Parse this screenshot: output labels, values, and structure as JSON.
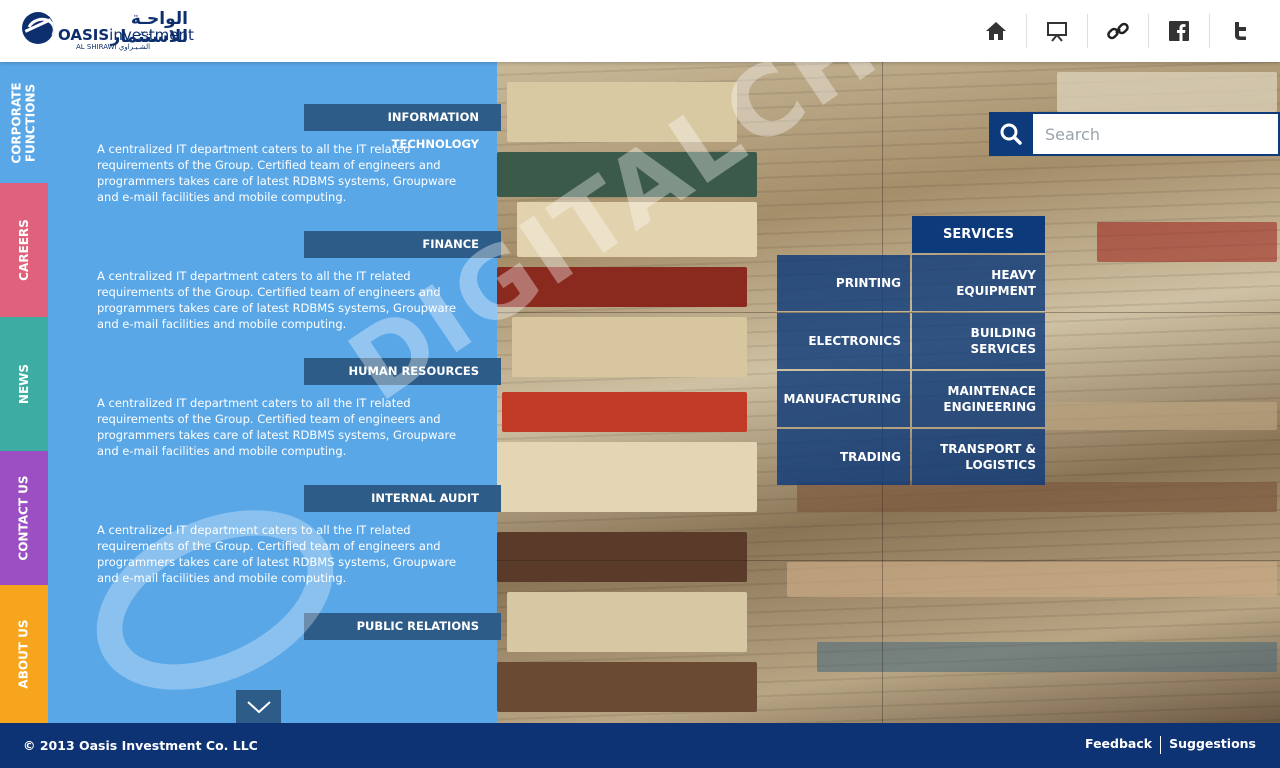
{
  "logo": {
    "arabic": "الواحـة للاستثمار",
    "name_bold": "OASIS",
    "name_rest": "investment",
    "sub_left": "AL SHIRAWI",
    "sub_right": "الشـيـراوي"
  },
  "header_icons": [
    "home-icon",
    "presentation-icon",
    "link-icon",
    "facebook-icon",
    "twitter-icon"
  ],
  "side_tabs": [
    {
      "label": "CORPORATE\nFUNCTIONS",
      "color": "#5aa7e8"
    },
    {
      "label": "CAREERS",
      "color": "#e0617c"
    },
    {
      "label": "NEWS",
      "color": "#3dada3"
    },
    {
      "label": "CONTACT US",
      "color": "#9b4fc2"
    },
    {
      "label": "ABOUT US",
      "color": "#f6a51c"
    }
  ],
  "departments": [
    {
      "title": "INFORMATION TECHNOLOGY",
      "text": "A centralized IT department caters to all the IT related requirements of the Group. Certified team of engineers and programmers takes care of latest RDBMS systems, Groupware and e-mail facilities and mobile computing."
    },
    {
      "title": "FINANCE",
      "text": "A centralized IT department caters to all the IT related requirements of the Group. Certified team of engineers and programmers takes care of latest RDBMS systems, Groupware and e-mail facilities and mobile computing."
    },
    {
      "title": "HUMAN RESOURCES",
      "text": "A centralized IT department caters to all the IT related requirements of the Group. Certified team of engineers and programmers takes care of latest RDBMS systems, Groupware and e-mail facilities and mobile computing."
    },
    {
      "title": "INTERNAL AUDIT",
      "text": "A centralized IT department caters to all the IT related requirements of the Group. Certified team of engineers and programmers takes care of latest RDBMS systems, Groupware and e-mail facilities and mobile computing."
    },
    {
      "title": "PUBLIC RELATIONS",
      "text": ""
    }
  ],
  "search": {
    "placeholder": "Search"
  },
  "services": {
    "title": "SERVICES",
    "items": [
      "PRINTING",
      "HEAVY EQUIPMENT",
      "ELECTRONICS",
      "BUILDING SERVICES",
      "MANUFACTURING",
      "MAINTENACE\nENGINEERING",
      "TRADING",
      "TRANSPORT &\nLOGISTICS"
    ]
  },
  "footer": {
    "copyright": "© 2013 Oasis Investment Co. LLC",
    "feedback": "Feedback",
    "suggestions": "Suggestions"
  },
  "watermark": "DIGITALCHAKRA",
  "colors": {
    "brand_navy": "#0d3374",
    "panel_blue": "#5aa7e8",
    "dept_header": "#2d5c88"
  }
}
